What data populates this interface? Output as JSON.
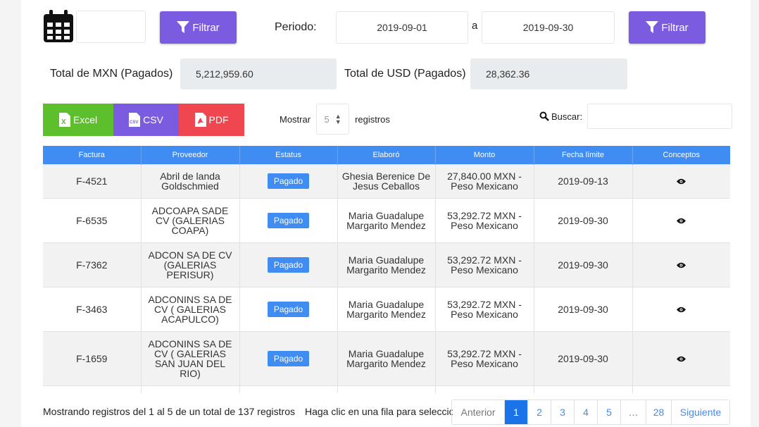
{
  "filters": {
    "filter_button_label": "Filtrar",
    "periodo_label": "Periodo:",
    "date_from": "2019-09-01",
    "date_separator": "a",
    "date_to": "2019-09-30",
    "filter_button2_label": "Filtrar"
  },
  "totals": {
    "mxn_label": "Total de MXN (Pagados)",
    "mxn_value": "5,212,959.60",
    "usd_label": "Total de USD (Pagados)",
    "usd_value": "28,362.36"
  },
  "export": {
    "excel_label": "Excel",
    "csv_label": "CSV",
    "pdf_label": "PDF"
  },
  "length": {
    "show_label": "Mostrar",
    "value": "5",
    "records_label": "registros"
  },
  "search": {
    "label": "Buscar:"
  },
  "table": {
    "headers": [
      "Factura",
      "Proveedor",
      "Estatus",
      "Elaboró",
      "Monto",
      "Fecha límite",
      "Conceptos"
    ],
    "rows": [
      {
        "factura": "F-4521",
        "proveedor": "Abril de landa Goldschmied",
        "estatus": "Pagado",
        "elaboro": "Ghesia Berenice De Jesus Ceballos",
        "monto": "27,840.00 MXN - Peso Mexicano",
        "fecha": "2019-09-13"
      },
      {
        "factura": "F-6535",
        "proveedor": "ADCOAPA SADE CV (GALERIAS COAPA)",
        "estatus": "Pagado",
        "elaboro": "Maria Guadalupe Margarito Mendez",
        "monto": "53,292.72 MXN - Peso Mexicano",
        "fecha": "2019-09-30"
      },
      {
        "factura": "F-7362",
        "proveedor": "ADCON SA DE CV (GALERIAS PERISUR)",
        "estatus": "Pagado",
        "elaboro": "Maria Guadalupe Margarito Mendez",
        "monto": "53,292.72 MXN - Peso Mexicano",
        "fecha": "2019-09-30"
      },
      {
        "factura": "F-3463",
        "proveedor": "ADCONINS SA DE CV ( GALERIAS ACAPULCO)",
        "estatus": "Pagado",
        "elaboro": "Maria Guadalupe Margarito Mendez",
        "monto": "53,292.72 MXN - Peso Mexicano",
        "fecha": "2019-09-30"
      },
      {
        "factura": "F-1659",
        "proveedor": "ADCONINS SA DE CV ( GALERIAS SAN JUAN DEL RIO)",
        "estatus": "Pagado",
        "elaboro": "Maria Guadalupe Margarito Mendez",
        "monto": "53,292.72 MXN - Peso Mexicano",
        "fecha": "2019-09-30"
      }
    ]
  },
  "footer": {
    "info": "Mostrando registros del 1 al 5 de un total de 137 registros",
    "hint": "Haga clic en una fila para selecciona",
    "pagination": {
      "previous": "Anterior",
      "pages": [
        "1",
        "2",
        "3",
        "4",
        "5",
        "…",
        "28"
      ],
      "next": "Siguiente"
    }
  },
  "colors": {
    "accent_purple": "#7b5ce1",
    "table_header_blue": "#3f8cf2",
    "excel_green": "#5dbf2c",
    "csv_purple": "#7b5ce1",
    "pdf_red": "#f04650"
  }
}
